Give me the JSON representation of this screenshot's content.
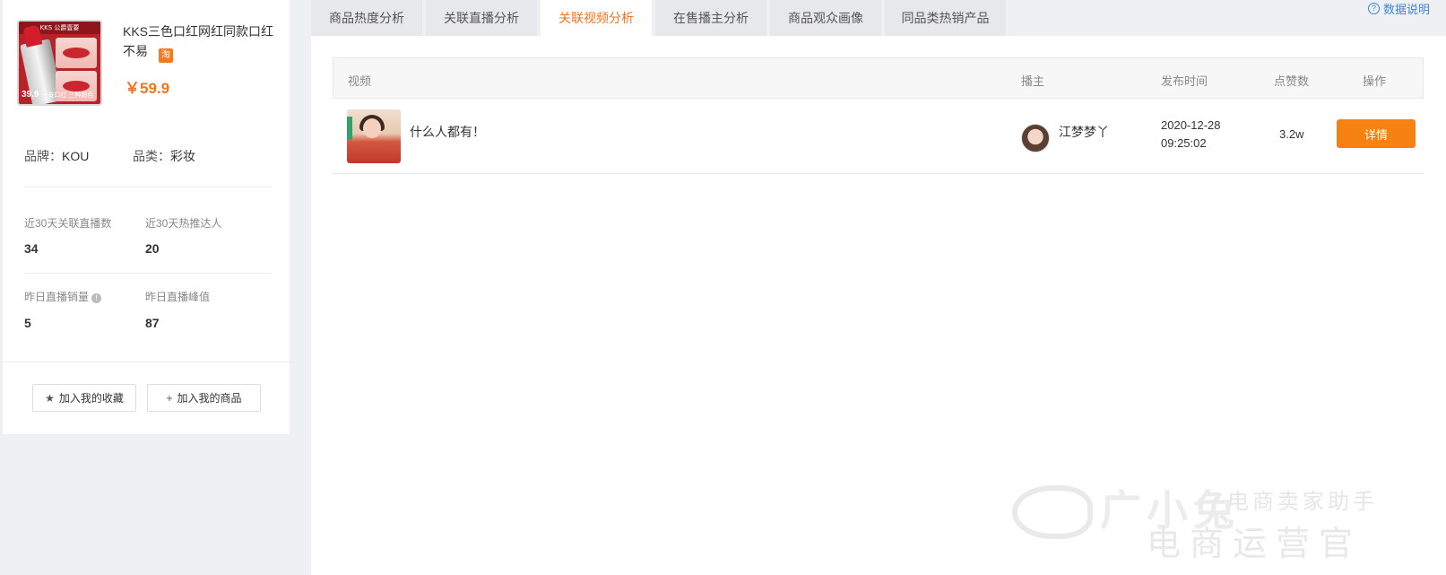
{
  "product": {
    "image_band": "KKS 公爵壹要",
    "image_price": "39.9",
    "image_caption": "一支口红 三种颜色",
    "title": "KKS三色口红网红同款口红不易",
    "platform_badge": "淘",
    "price": "￥59.9",
    "brand_label": "品牌：",
    "brand_value": "KOU",
    "category_label": "品类：",
    "category_value": "彩妆"
  },
  "stats": [
    {
      "label": "近30天关联直播数",
      "value": "34"
    },
    {
      "label": "近30天热推达人",
      "value": "20"
    },
    {
      "label": "昨日直播销量",
      "value": "5"
    },
    {
      "label": "昨日直播峰值",
      "value": "87"
    }
  ],
  "actions": {
    "favorite": "加入我的收藏",
    "add_product": "加入我的商品"
  },
  "tabs": [
    {
      "label": "商品热度分析"
    },
    {
      "label": "关联直播分析"
    },
    {
      "label": "关联视频分析",
      "active": true
    },
    {
      "label": "在售播主分析"
    },
    {
      "label": "商品观众画像"
    },
    {
      "label": "同品类热销产品"
    }
  ],
  "help": "数据说明",
  "table": {
    "headers": {
      "video": "视频",
      "anchor": "播主",
      "time": "发布时间",
      "likes": "点赞数",
      "action": "操作"
    },
    "rows": [
      {
        "title": "什么人都有！",
        "anchor": "江梦梦丫",
        "date": "2020-12-28",
        "time": "09:25:02",
        "likes": "3.2w",
        "action": "详情"
      }
    ]
  },
  "watermark": {
    "brand": "广小兔",
    "tagline": "电商卖家助手",
    "slogan": "电商运营官"
  },
  "colors": {
    "accent": "#f3741d",
    "button": "#f58212",
    "link": "#3d86d6"
  }
}
